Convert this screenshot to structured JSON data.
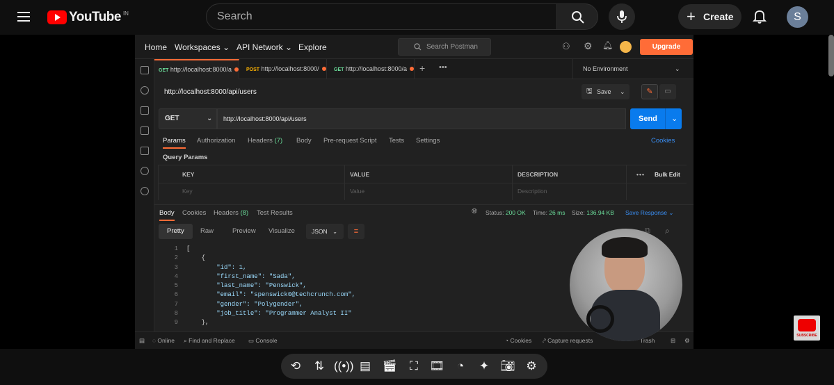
{
  "youtube": {
    "logo_text": "YouTube",
    "country_code": "IN",
    "search_placeholder": "Search",
    "create_label": "Create",
    "avatar_letter": "S"
  },
  "postman": {
    "nav": [
      "Home",
      "Workspaces",
      "API Network",
      "Explore"
    ],
    "search_placeholder": "Search Postman",
    "upgrade_label": "Upgrade",
    "tabs": [
      {
        "method": "GET",
        "url": "http://localhost:8000/a"
      },
      {
        "method": "POST",
        "url": "http://localhost:8000/"
      },
      {
        "method": "GET",
        "url": "http://localhost:8000/a"
      }
    ],
    "environment": "No Environment",
    "request_title": "http://localhost:8000/api/users",
    "save_label": "Save",
    "method": "GET",
    "url": "http://localhost:8000/api/users",
    "send_label": "Send",
    "request_tabs": [
      "Params",
      "Authorization",
      "Headers",
      "Body",
      "Pre-request Script",
      "Tests",
      "Settings"
    ],
    "headers_count": "(7)",
    "cookies_label": "Cookies",
    "query_params_label": "Query Params",
    "table_headers": [
      "KEY",
      "VALUE",
      "DESCRIPTION"
    ],
    "bulk_edit_label": "Bulk Edit",
    "placeholders": [
      "Key",
      "Value",
      "Description"
    ],
    "response_tabs": [
      "Body",
      "Cookies",
      "Headers",
      "Test Results"
    ],
    "response_headers_count": "(8)",
    "status_label": "Status:",
    "status_value": "200 OK",
    "time_label": "Time:",
    "time_value": "26 ms",
    "size_label": "Size:",
    "size_value": "136.94 KB",
    "save_response_label": "Save Response",
    "view_modes": [
      "Pretty",
      "Raw",
      "Preview",
      "Visualize"
    ],
    "format": "JSON",
    "code_lines": [
      {
        "n": "1",
        "text": "["
      },
      {
        "n": "2",
        "text": "    {"
      },
      {
        "n": "3",
        "text": "        \"id\": 1,"
      },
      {
        "n": "4",
        "text": "        \"first_name\": \"Sada\","
      },
      {
        "n": "5",
        "text": "        \"last_name\": \"Penswick\","
      },
      {
        "n": "6",
        "text": "        \"email\": \"spenswick0@techcrunch.com\","
      },
      {
        "n": "7",
        "text": "        \"gender\": \"Polygender\","
      },
      {
        "n": "8",
        "text": "        \"job_title\": \"Programmer Analyst II\""
      },
      {
        "n": "9",
        "text": "    },"
      }
    ],
    "status_bar": [
      "Online",
      "Find and Replace",
      "Console",
      "Cookies",
      "Capture requests",
      "Trash"
    ]
  },
  "subscribe_badge": "SUBSCRIBE"
}
